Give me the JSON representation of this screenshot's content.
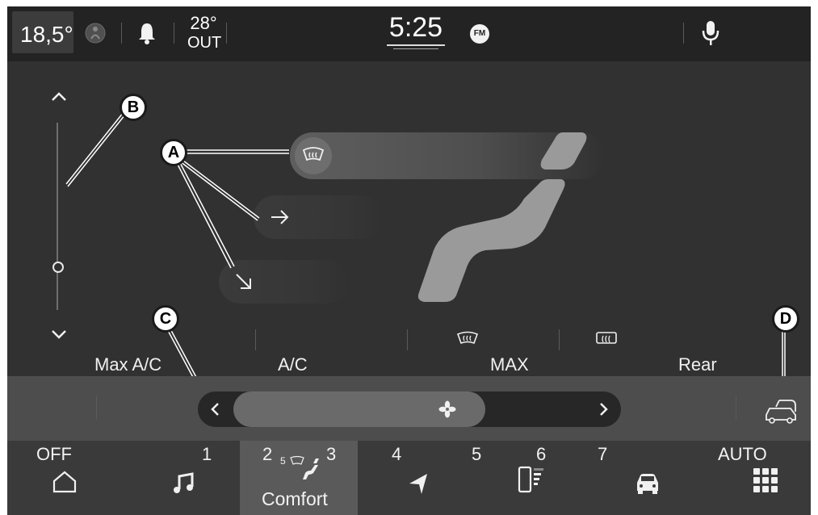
{
  "status_bar": {
    "cabin_temp": "18,5°",
    "outside_temp": "28°",
    "outside_label": "OUT",
    "time": "5:25",
    "source_badge": "FM",
    "icons": [
      "seat-belt-icon",
      "bell-icon",
      "microphone-icon"
    ]
  },
  "airflow": {
    "modes": [
      {
        "icon": "defrost-windshield-icon",
        "active": true
      },
      {
        "icon": "arrow-right-icon",
        "active": false
      },
      {
        "icon": "arrow-down-right-icon",
        "active": false
      }
    ]
  },
  "callouts": {
    "a": "A",
    "b": "B",
    "c": "C",
    "d": "D"
  },
  "temp_slider": {
    "level": 0.2,
    "up_icon": "chevron-up-icon",
    "down_icon": "chevron-down-icon"
  },
  "climate_buttons": [
    {
      "label": "Max A/C"
    },
    {
      "label": "A/C"
    },
    {
      "label": "MAX",
      "icon": "front-defrost-icon"
    },
    {
      "label": "Rear",
      "icon": "rear-defrost-icon"
    }
  ],
  "fan": {
    "icon": "fan-icon",
    "prev_icon": "chevron-left-icon",
    "next_icon": "chevron-right-icon",
    "level_fraction": 0.6,
    "recirc_icon": "recirculation-car-icon"
  },
  "bottom_bar": {
    "off_label": "OFF",
    "num1": "1",
    "num2": "2",
    "num3": "3",
    "num4": "4",
    "num5": "5",
    "num6": "6",
    "num7": "7",
    "auto_label": "AUTO",
    "comfort_label": "Comfort",
    "comfort_small": "5",
    "icons": [
      "home-icon",
      "music-note-icon",
      "seat-icon",
      "navigation-arrow-icon",
      "phone-icon",
      "car-icon",
      "apps-grid-icon"
    ]
  },
  "colors": {
    "background": "#313131",
    "topbar": "#232323",
    "active_pill": "#5f5f5f",
    "seat": "#9a9a9a",
    "text": "#ffffff"
  }
}
